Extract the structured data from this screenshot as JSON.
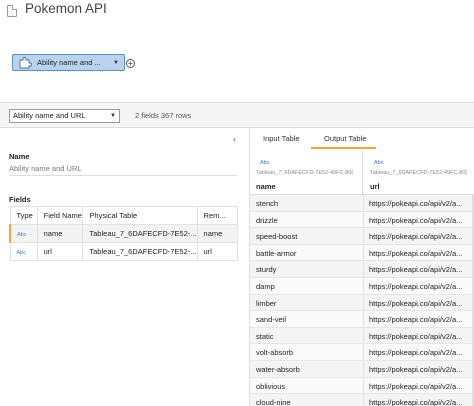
{
  "app": {
    "title": "Pokemon API"
  },
  "flow": {
    "node_label": "Ability name and ...",
    "accent_color": "#b9d3ee"
  },
  "toolbar": {
    "step_select_value": "Ability name and URL",
    "stats": "2 fields 367 rows"
  },
  "left_panel": {
    "name_label": "Name",
    "name_value": "Ability name and URL",
    "fields_label": "Fields",
    "table_headers": [
      "Type",
      "Field Name",
      "Physical Table",
      "Rem..."
    ],
    "fields": [
      {
        "type": "Abc",
        "name": "name",
        "physical_table": "Tableau_7_6DAFECFD-7E52-...",
        "remote": "name"
      },
      {
        "type": "Abc",
        "name": "url",
        "physical_table": "Tableau_7_6DAFECFD-7E52-...",
        "remote": "url"
      }
    ]
  },
  "right_panel": {
    "tabs": [
      "Input Table",
      "Output Table"
    ],
    "active_tab": "Output Table",
    "columns": [
      {
        "type": "Abc",
        "source": "Tableau_7_6DAFECFD-7E52-49FC-80(",
        "name": "name"
      },
      {
        "type": "Abc",
        "source": "Tableau_7_6DAFECFD-7E52-49FC-80(",
        "name": "url"
      }
    ],
    "rows": [
      [
        "stench",
        "https://pokeapi.co/api/v2/a..."
      ],
      [
        "drizzle",
        "https://pokeapi.co/api/v2/a..."
      ],
      [
        "speed-boost",
        "https://pokeapi.co/api/v2/a..."
      ],
      [
        "battle-armor",
        "https://pokeapi.co/api/v2/a..."
      ],
      [
        "sturdy",
        "https://pokeapi.co/api/v2/a..."
      ],
      [
        "damp",
        "https://pokeapi.co/api/v2/a..."
      ],
      [
        "limber",
        "https://pokeapi.co/api/v2/a..."
      ],
      [
        "sand-veil",
        "https://pokeapi.co/api/v2/a..."
      ],
      [
        "static",
        "https://pokeapi.co/api/v2/a..."
      ],
      [
        "volt-absorb",
        "https://pokeapi.co/api/v2/a..."
      ],
      [
        "water-absorb",
        "https://pokeapi.co/api/v2/a..."
      ],
      [
        "oblivious",
        "https://pokeapi.co/api/v2/a..."
      ],
      [
        "cloud-nine",
        "https://pokeapi.co/api/v2/a..."
      ]
    ]
  }
}
